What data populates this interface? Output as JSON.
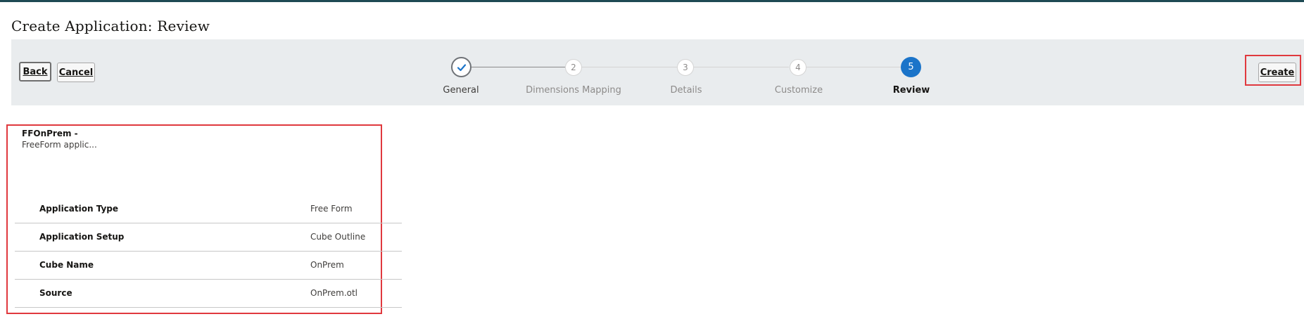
{
  "page": {
    "title": "Create Application: Review"
  },
  "toolbar": {
    "back_label": "Back",
    "cancel_label": "Cancel",
    "create_label": "Create"
  },
  "train": {
    "steps": [
      {
        "number": "",
        "label": "General",
        "state": "completed",
        "icon": "checkmark-icon"
      },
      {
        "number": "2",
        "label": "Dimensions Mapping",
        "state": "upcoming"
      },
      {
        "number": "3",
        "label": "Details",
        "state": "upcoming"
      },
      {
        "number": "4",
        "label": "Customize",
        "state": "upcoming"
      },
      {
        "number": "5",
        "label": "Review",
        "state": "current"
      }
    ]
  },
  "summary": {
    "app_name": "FFOnPrem -",
    "app_description": "FreeForm applic...",
    "rows": [
      {
        "label": "Application Type",
        "value": "Free Form"
      },
      {
        "label": "Application Setup",
        "value": "Cube Outline"
      },
      {
        "label": "Cube Name",
        "value": "OnPrem"
      },
      {
        "label": "Source",
        "value": "OnPrem.otl"
      }
    ]
  },
  "colors": {
    "accent": "#1b74c9",
    "header_bar": "#1e4a54",
    "highlight": "#e0393e",
    "train_background": "#e9ecee"
  }
}
